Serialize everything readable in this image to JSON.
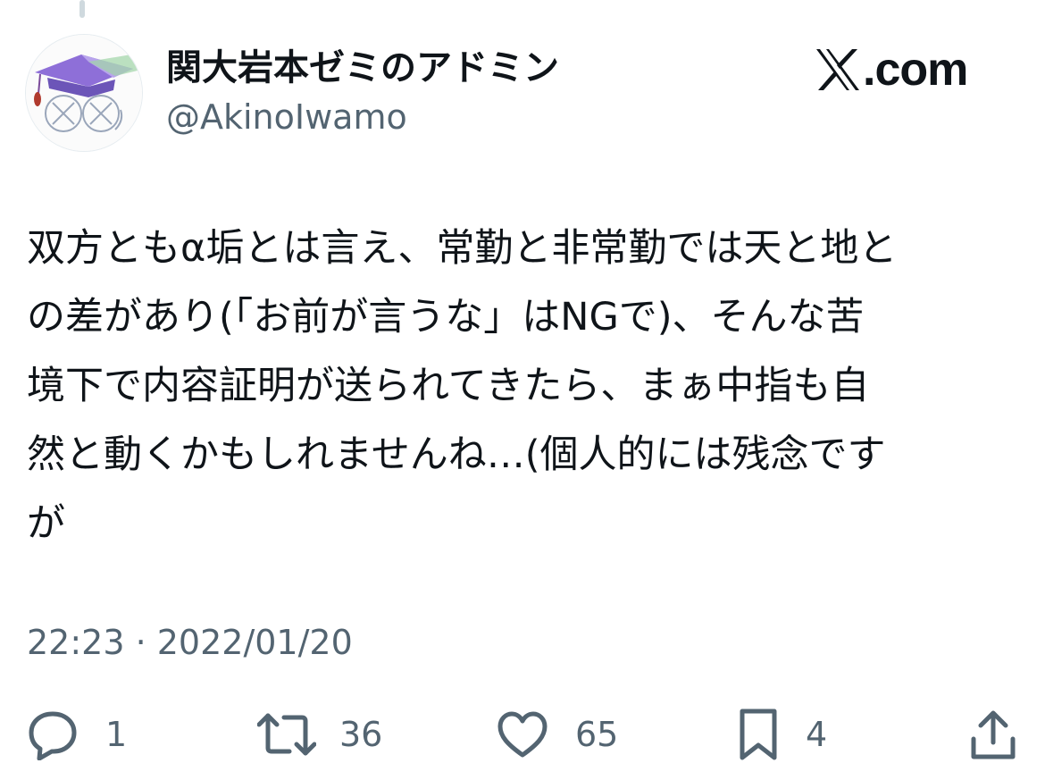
{
  "author": {
    "display_name": "関大岩本ゼミのアドミン",
    "handle": "@AkinoIwamo"
  },
  "brand": {
    "domain": ".com",
    "logo_icon": "x-logo-icon"
  },
  "tweet": {
    "lines": [
      "双方ともα垢とは言え、常勤と非常勤では天と地と",
      "の差があり(「お前が言うな」はNGで)、そんな苦",
      "境下で内容証明が送られてきたら、まぁ中指も自",
      "然と動くかもしれませんね…(個人的には残念です",
      "が"
    ],
    "timestamp": "22:23 · 2022/01/20"
  },
  "actions": {
    "reply": {
      "icon": "reply-icon",
      "count": "1"
    },
    "retweet": {
      "icon": "retweet-icon",
      "count": "36"
    },
    "like": {
      "icon": "heart-icon",
      "count": "65"
    },
    "bookmark": {
      "icon": "bookmark-icon",
      "count": "4"
    },
    "share": {
      "icon": "share-icon"
    }
  },
  "colors": {
    "text_primary": "#0f1419",
    "text_secondary": "#536471",
    "icon": "#536471",
    "thread_line": "#cfd9de"
  }
}
